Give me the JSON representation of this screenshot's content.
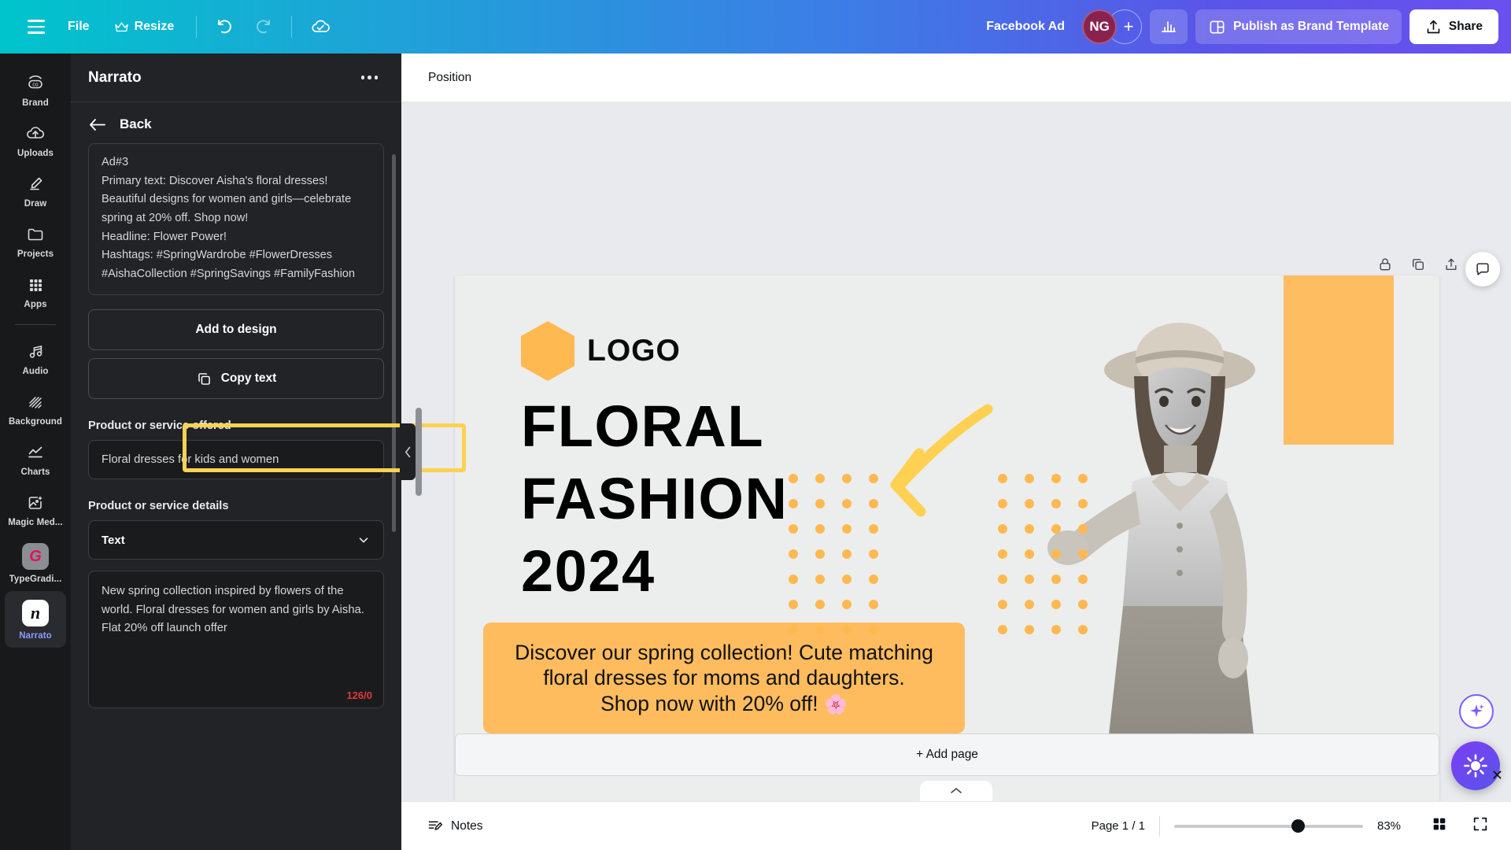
{
  "topbar": {
    "menu_icon": "hamburger-icon",
    "file_label": "File",
    "resize_label": "Resize",
    "resize_crown_icon": "crown-icon",
    "undo_icon": "undo-icon",
    "redo_icon": "redo-icon",
    "cloud_saved_icon": "cloud-check-icon",
    "doc_title": "Facebook Ad",
    "avatar_initials": "NG",
    "avatar_color": "#8a2250",
    "add_collaborator_label": "+",
    "insights_icon": "bar-chart-icon",
    "brand_template_icon": "layout-icon",
    "publish_label": "Publish as Brand Template",
    "share_icon": "share-upload-icon",
    "share_label": "Share"
  },
  "rail": {
    "items": [
      {
        "label": "Brand",
        "icon": "brand-icon",
        "active": false
      },
      {
        "label": "Uploads",
        "icon": "upload-cloud-icon",
        "active": false
      },
      {
        "label": "Draw",
        "icon": "pencil-icon",
        "active": false
      },
      {
        "label": "Projects",
        "icon": "folder-icon",
        "active": false
      },
      {
        "label": "Apps",
        "icon": "grid-apps-icon",
        "active": false
      },
      {
        "label": "Audio",
        "icon": "music-note-icon",
        "active": false
      },
      {
        "label": "Background",
        "icon": "hatch-pattern-icon",
        "active": false
      },
      {
        "label": "Charts",
        "icon": "line-chart-icon",
        "active": false
      },
      {
        "label": "Magic Med...",
        "icon": "magic-media-icon",
        "active": false
      },
      {
        "label": "TypeGradi...",
        "icon": "typegradient-app-icon",
        "active": false
      },
      {
        "label": "Narrato",
        "icon": "narrato-app-icon",
        "active": true
      }
    ]
  },
  "panel": {
    "title": "Narrato",
    "more_icon": "more-options-icon",
    "back_label": "Back",
    "back_icon": "arrow-left-icon",
    "ad_text": "Ad#3\nPrimary text: Discover Aisha's floral dresses! Beautiful designs for women and girls—celebrate spring at 20% off. Shop now!\nHeadline: Flower Power!\nHashtags: #SpringWardrobe #FlowerDresses #AishaCollection #SpringSavings #FamilyFashion",
    "add_to_design_label": "Add to design",
    "copy_text_label": "Copy text",
    "copy_icon": "copy-icon",
    "product_offered_label": "Product or service offered",
    "product_offered_value": "Floral dresses for kids and women",
    "product_details_label": "Product or service details",
    "details_type_value": "Text",
    "details_chevron_icon": "chevron-down-icon",
    "details_value": "New spring collection inspired by flowers of the world. Floral dresses for women and girls by Aisha. Flat 20% off launch offer",
    "char_count": "126/0",
    "collapse_icon": "chevron-left-icon"
  },
  "toolbar": {
    "position_label": "Position"
  },
  "canvas": {
    "lock_icon": "lock-icon",
    "duplicate_icon": "duplicate-icon",
    "export_icon": "export-icon",
    "logo_text": "LOGO",
    "headline_line1": "FLORAL",
    "headline_line2": "FASHION",
    "headline_line3": "2024",
    "promo_text": "Discover our spring collection! Cute matching floral dresses for moms and daughters.\nShop now with 20% off!",
    "promo_emoji": "🌸",
    "accent_orange": "#ffbc5e",
    "add_page_label": "+ Add page",
    "collapse_tab_icon": "chevron-up-icon"
  },
  "statusbar": {
    "notes_icon": "notes-icon",
    "notes_label": "Notes",
    "page_label": "Page 1 / 1",
    "zoom_value": "83%",
    "grid_icon": "grid-view-icon"
  },
  "floating": {
    "comment_icon": "comment-icon",
    "magic_icon": "magic-sparkle-icon",
    "assistant_icon": "assistant-sparkle-icon",
    "close_icon": "close-x-icon"
  }
}
